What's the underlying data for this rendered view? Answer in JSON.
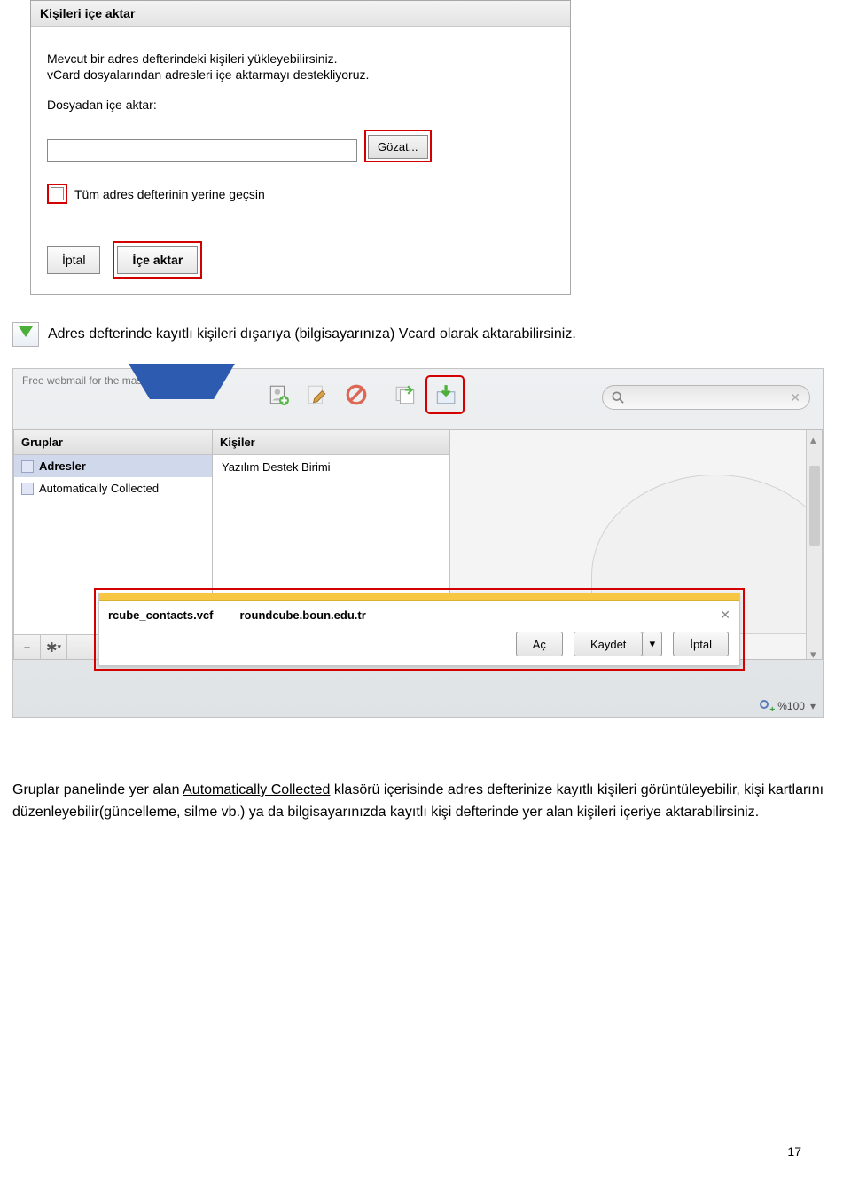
{
  "dialog": {
    "title": "Kişileri içe aktar",
    "desc1": "Mevcut bir adres defterindeki kişileri yükleyebilirsiniz.",
    "desc2": "vCard dosyalarından adresleri içe aktarmayı destekliyoruz.",
    "file_label": "Dosyadan içe aktar:",
    "browse": "Gözat...",
    "replace_label": "Tüm adres defterinin yerine geçsin",
    "cancel": "İptal",
    "import": "İçe aktar"
  },
  "instruction": "Adres defterinde kayıtlı kişileri dışarıya (bilgisayarınıza) Vcard olarak aktarabilirsiniz.",
  "webmail": {
    "tagline": "Free webmail for the masses",
    "groups_hdr": "Gruplar",
    "group_adresler": "Adresler",
    "group_auto": "Automatically Collected",
    "contacts_hdr": "Kişiler",
    "contact1": "Yazılım Destek Birimi",
    "download": {
      "file": "rcube_contacts.vcf",
      "host": "roundcube.boun.edu.tr",
      "open": "Aç",
      "save": "Kaydet",
      "cancel": "İptal"
    },
    "zoom": "%100"
  },
  "paragraph": {
    "t1": "Gruplar panelinde yer alan ",
    "u": "Automatically Collected",
    "t2": " klasörü içerisinde adres defterinize kayıtlı kişileri görüntüleyebilir, kişi kartlarını düzenleyebilir(güncelleme, silme vb.) ya da bilgisayarınızda kayıtlı kişi defterinde yer alan kişileri içeriye aktarabilirsiniz."
  },
  "page_number": "17"
}
